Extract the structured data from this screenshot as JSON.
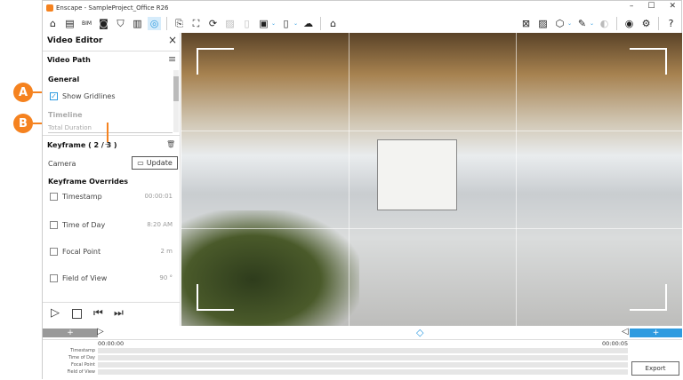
{
  "window": {
    "title": "Enscape - SampleProject_Office R26",
    "minimize": "–",
    "maximize": "☐",
    "close": "✕"
  },
  "callouts": {
    "a": "A",
    "b": "B",
    "color": "#f5821f"
  },
  "toolbar": {
    "left_icons": [
      "home-icon",
      "assets-icon",
      "bim-icon",
      "view-icon",
      "shield-icon",
      "buildings-icon",
      "video-editor-icon",
      "export-icon",
      "screenshot-icon",
      "panorama-icon",
      "image-icon",
      "file-icon",
      "vr-icon",
      "batch-icon",
      "cloud-icon",
      "upload-icon"
    ],
    "right_icons": [
      "map-icon",
      "image-view-icon",
      "cube-icon",
      "asset-icon",
      "vr-headset-icon",
      "eye-icon",
      "settings-icon",
      "help-icon"
    ],
    "accent": "#2e9be0"
  },
  "panel": {
    "title": "Video Editor",
    "section": "Video Path",
    "general": "General",
    "show_gridlines": "Show Gridlines",
    "show_gridlines_checked": true,
    "timeline": "Timeline",
    "total_duration": "Total Duration",
    "keyframe": "Keyframe ( 2 / 3 )",
    "camera": "Camera",
    "update": "Update",
    "overrides_title": "Keyframe Overrides",
    "overrides": [
      {
        "label": "Timestamp",
        "value": "00:00:01"
      },
      {
        "label": "Time of Day",
        "value": "8:20 AM"
      },
      {
        "label": "Focal Point",
        "value": "2 m"
      },
      {
        "label": "Field of View",
        "value": "90 °"
      }
    ]
  },
  "timeline": {
    "add_left": "+",
    "add_right": "+",
    "start": "00:00:00",
    "end": "00:00:05",
    "rows": [
      "Timestamp",
      "Time of Day",
      "Focal Point",
      "Field of View"
    ],
    "export": "Export"
  }
}
